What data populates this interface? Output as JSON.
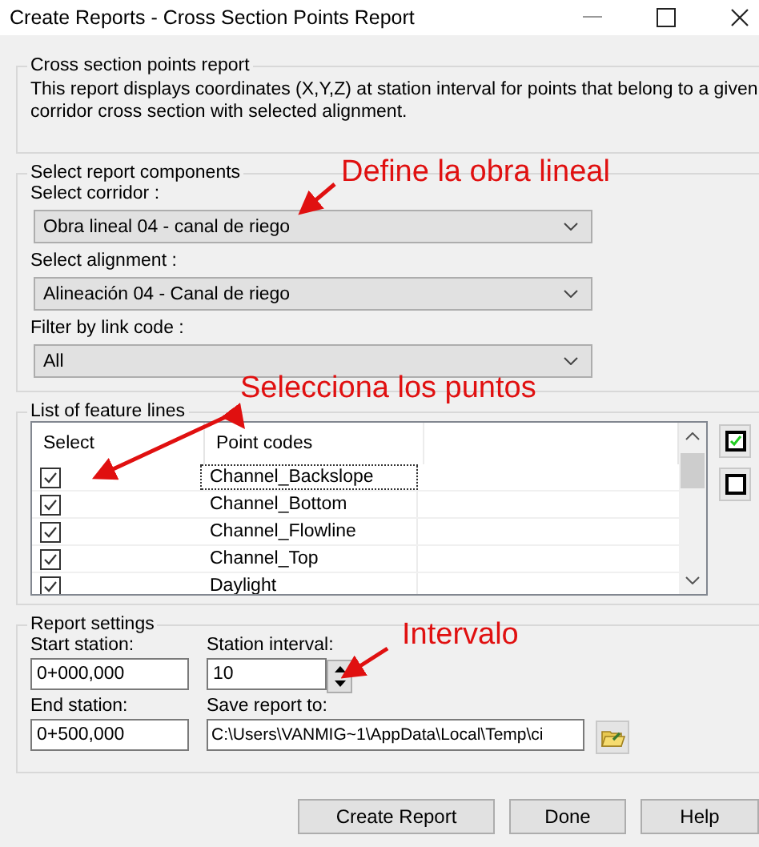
{
  "window": {
    "title": "Create Reports - Cross Section Points Report"
  },
  "description_group": {
    "title": "Cross section points report",
    "text": "This report displays coordinates (X,Y,Z) at station interval for points that belong to a given corridor cross section with selected alignment."
  },
  "components_group": {
    "title": "Select report components",
    "fields": [
      {
        "label": "Select corridor :",
        "value": "Obra lineal 04 - canal de riego"
      },
      {
        "label": "Select alignment :",
        "value": "Alineación 04 - Canal de riego"
      },
      {
        "label": "Filter by link code :",
        "value": "All"
      }
    ]
  },
  "feature_lines": {
    "title": "List of feature lines",
    "columns": [
      "Select",
      "Point codes"
    ],
    "rows": [
      {
        "checked": true,
        "code": "Channel_Backslope",
        "focused": true
      },
      {
        "checked": true,
        "code": "Channel_Bottom",
        "focused": false
      },
      {
        "checked": true,
        "code": "Channel_Flowline",
        "focused": false
      },
      {
        "checked": true,
        "code": "Channel_Top",
        "focused": false
      },
      {
        "checked": true,
        "code": "Daylight",
        "focused": false
      }
    ]
  },
  "report_settings": {
    "title": "Report settings",
    "start_label": "Start station:",
    "start_value": "0+000,000",
    "interval_label": "Station interval:",
    "interval_value": "10",
    "end_label": "End station:",
    "end_value": "0+500,000",
    "save_label": "Save report to:",
    "save_value": "C:\\Users\\VANMIG~1\\AppData\\Local\\Temp\\ci"
  },
  "buttons": [
    "Create Report",
    "Done",
    "Help"
  ],
  "annotations": [
    {
      "text": "Define la obra lineal"
    },
    {
      "text": "Selecciona los puntos"
    },
    {
      "text": "Intervalo"
    }
  ]
}
